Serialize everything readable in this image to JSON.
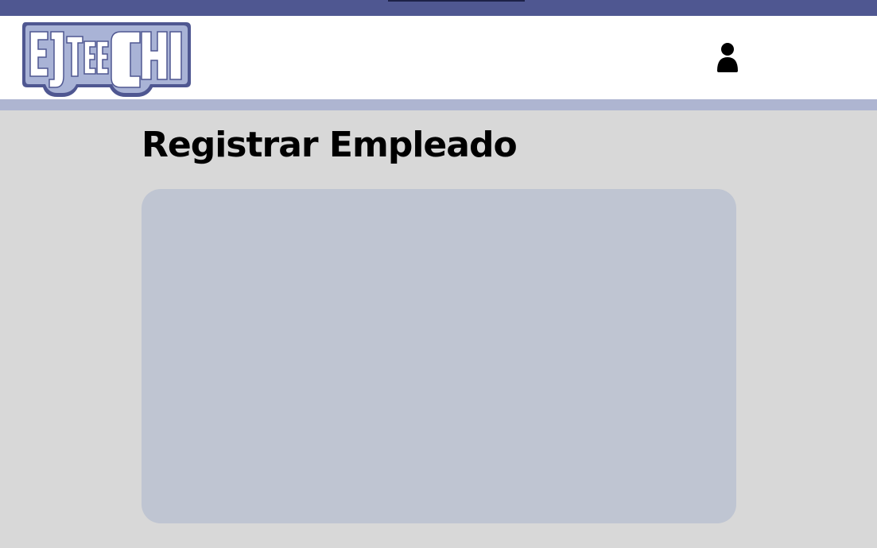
{
  "brand": {
    "logo_text": "EJTEECHI",
    "colors": {
      "primary": "#4f5791",
      "logo_fill": "#a9b3d6",
      "stripe": "#aeb5d1"
    }
  },
  "header": {
    "user_icon": "user-icon"
  },
  "main": {
    "title": "Registrar Empleado",
    "card_color": "#bfc5d2",
    "background": "#d8d8d8"
  }
}
